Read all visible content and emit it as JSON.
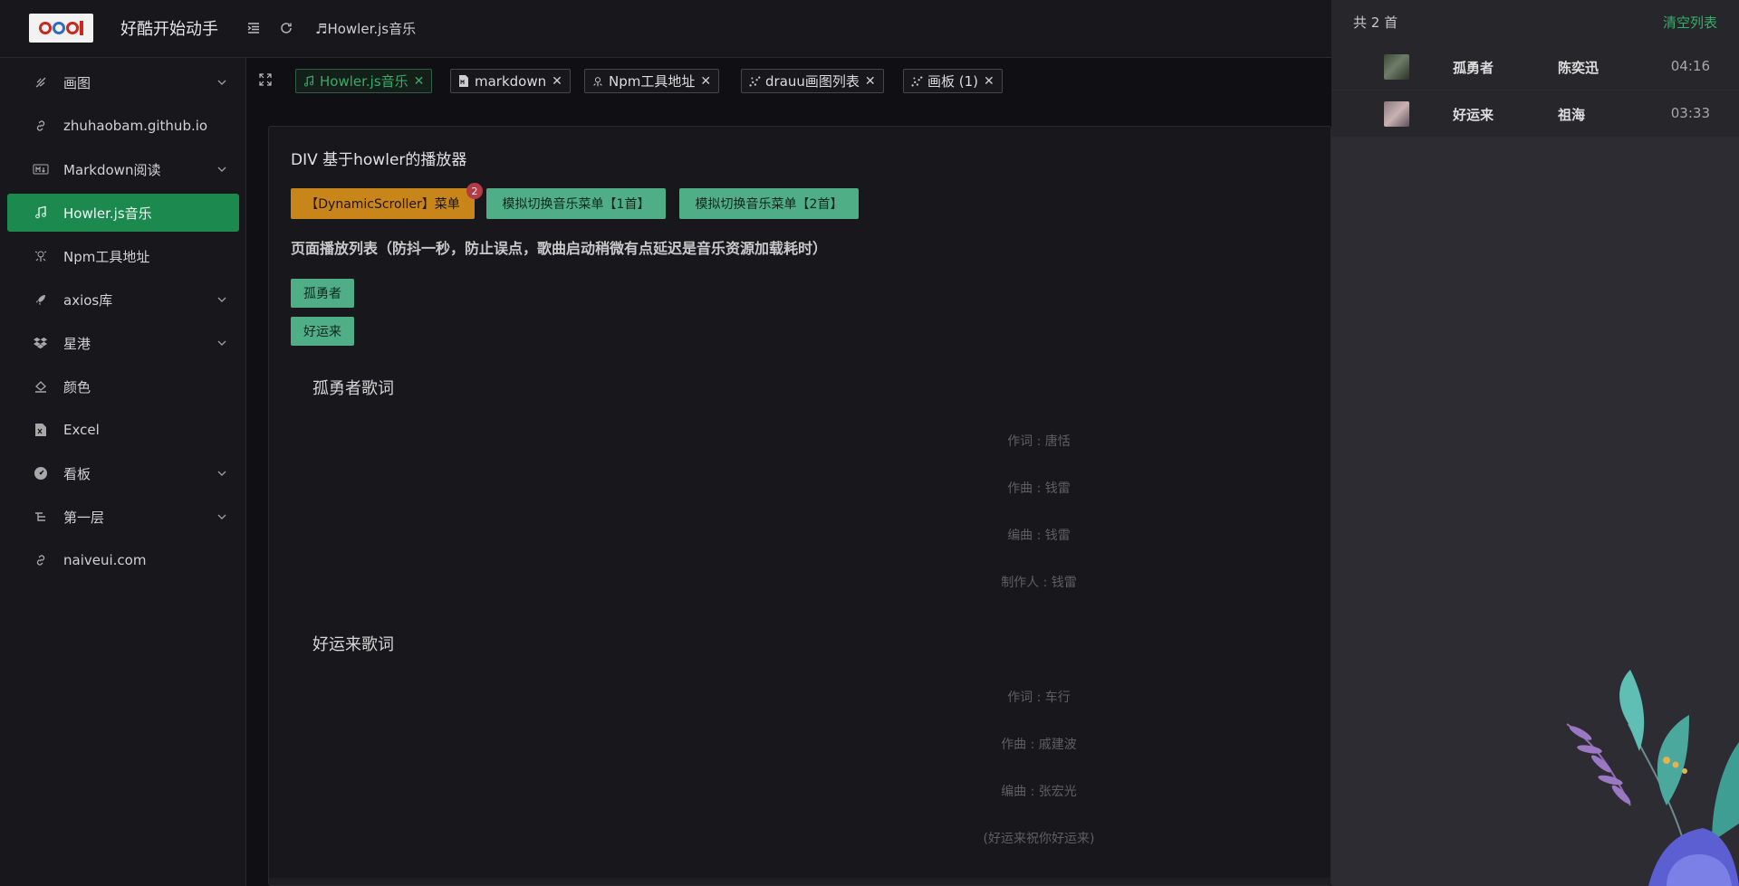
{
  "header": {
    "app_title": "好酷开始动手",
    "breadcrumb": "♬Howler.js音乐"
  },
  "sidebar": {
    "items": [
      {
        "label": "画图",
        "icon": "brush-icon",
        "has_children": true
      },
      {
        "label": "zhuhaobam.github.io",
        "icon": "link-icon",
        "has_children": false
      },
      {
        "label": "Markdown阅读",
        "icon": "markdown-icon",
        "has_children": true
      },
      {
        "label": "Howler.js音乐",
        "icon": "music-note-icon",
        "has_children": false,
        "active": true
      },
      {
        "label": "Npm工具地址",
        "icon": "npm-icon",
        "has_children": false
      },
      {
        "label": "axios库",
        "icon": "rocket-icon",
        "has_children": true
      },
      {
        "label": "星港",
        "icon": "dropbox-icon",
        "has_children": true
      },
      {
        "label": "颜色",
        "icon": "paint-bucket-icon",
        "has_children": false
      },
      {
        "label": "Excel",
        "icon": "excel-file-icon",
        "has_children": false
      },
      {
        "label": "看板",
        "icon": "dashboard-gauge-icon",
        "has_children": true
      },
      {
        "label": "第一层",
        "icon": "tree-icon",
        "has_children": true
      },
      {
        "label": "naiveui.com",
        "icon": "link-icon",
        "has_children": false
      }
    ]
  },
  "tabs": [
    {
      "label": "Howler.js音乐",
      "icon": "music-note-icon",
      "active": true
    },
    {
      "label": "markdown",
      "icon": "markdown-file-icon",
      "active": false
    },
    {
      "label": "Npm工具地址",
      "icon": "npm-icon",
      "active": false
    },
    {
      "label": "drauu画图列表",
      "icon": "scatter-icon",
      "active": false
    },
    {
      "label": "画板 (1)",
      "icon": "scatter-icon",
      "active": false
    }
  ],
  "card": {
    "title": "DIV 基于howler的播放器",
    "buttons": {
      "dynamic_menu": "【DynamicScroller】菜单",
      "dynamic_badge": "2",
      "switch_one": "模拟切换音乐菜单【1首】",
      "switch_two": "模拟切换音乐菜单【2首】"
    },
    "playlist_title": "页面播放列表（防抖一秒，防止误点，歌曲启动稍微有点延迟是音乐资源加载耗时）",
    "songs": [
      "孤勇者",
      "好运来"
    ],
    "lyrics": [
      {
        "title": "孤勇者歌词",
        "lines": [
          "作词 : 唐恬",
          "作曲 : 钱雷",
          "编曲 : 钱雷",
          "制作人 : 钱雷"
        ]
      },
      {
        "title": "好运来歌词",
        "lines": [
          "作词 : 车行",
          "作曲 : 戚建波",
          "编曲 : 张宏光",
          "(好运来祝你好运来)"
        ]
      }
    ]
  },
  "drawer": {
    "count": "共 2 首",
    "clear": "清空列表",
    "songs": [
      {
        "name": "孤勇者",
        "artist": "陈奕迅",
        "duration": "04:16"
      },
      {
        "name": "好运来",
        "artist": "祖海",
        "duration": "03:33"
      }
    ]
  },
  "colors": {
    "accent": "#18a058",
    "accent_text": "#36ad6a",
    "warning": "#c8851a",
    "button_green": "#4fae85",
    "badge": "#b43a46"
  }
}
